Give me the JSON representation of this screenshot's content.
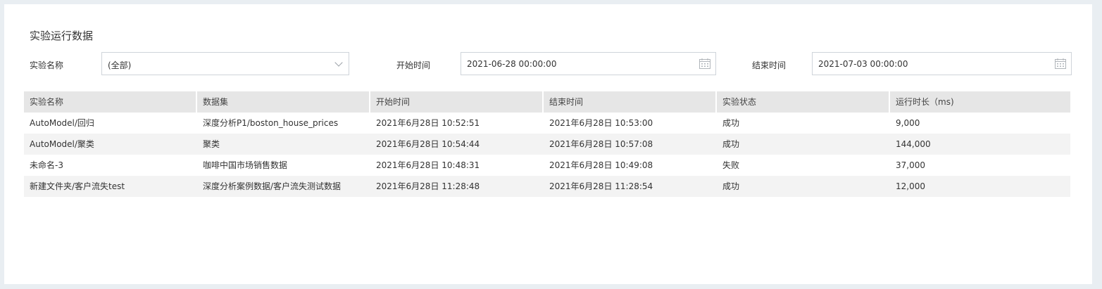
{
  "page": {
    "title": "实验运行数据"
  },
  "filters": {
    "experiment_label": "实验名称",
    "experiment_value": "(全部)",
    "start_label": "开始时间",
    "start_value": "2021-06-28 00:00:00",
    "end_label": "结束时间",
    "end_value": "2021-07-03 00:00:00"
  },
  "table": {
    "headers": [
      "实验名称",
      "数据集",
      "开始时间",
      "结束时间",
      "实验状态",
      "运行时长（ms)"
    ],
    "rows": [
      [
        "AutoModel/回归",
        "深度分析P1/boston_house_prices",
        "2021年6月28日 10:52:51",
        "2021年6月28日 10:53:00",
        "成功",
        "9,000"
      ],
      [
        "AutoModel/聚类",
        "聚类",
        "2021年6月28日 10:54:44",
        "2021年6月28日 10:57:08",
        "成功",
        "144,000"
      ],
      [
        "未命名-3",
        "咖啡中国市场销售数据",
        "2021年6月28日 10:48:31",
        "2021年6月28日 10:49:08",
        "失败",
        "37,000"
      ],
      [
        "新建文件夹/客户流失test",
        "深度分析案例数据/客户流失测试数据",
        "2021年6月28日 11:28:48",
        "2021年6月28日 11:28:54",
        "成功",
        "12,000"
      ]
    ]
  },
  "icons": {
    "select_arrow": "chevron-down-icon",
    "date_picker": "calendar-icon"
  },
  "colors": {
    "page_background": "#e9eef2",
    "header_background": "#e6e6e6",
    "striped_row": "#f3f3f3",
    "border": "#cfd4da"
  }
}
